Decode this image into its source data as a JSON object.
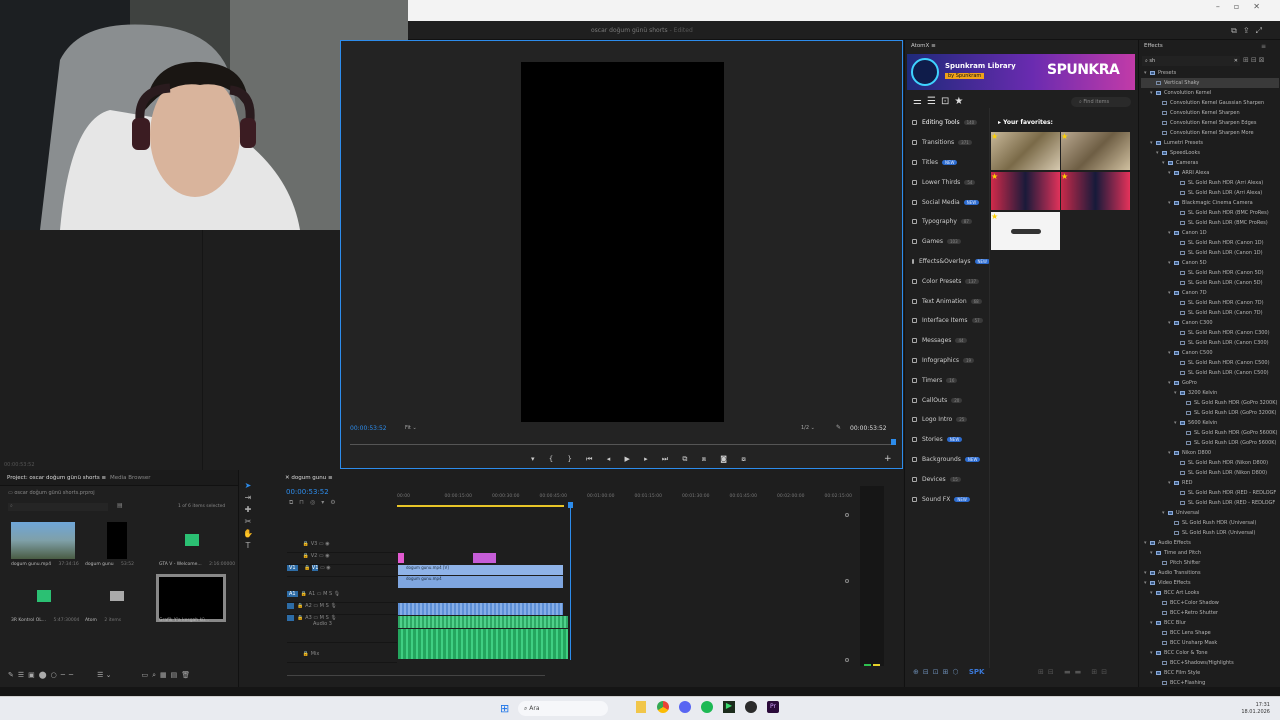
{
  "window": {
    "title": "oscar doğum günü shorts",
    "title_suffix": "- Edited"
  },
  "program_monitor": {
    "timecode_left": "00:00:53:52",
    "fit": "Fit",
    "resolution": "1/2",
    "timecode_right": "00:00:53:52"
  },
  "source_tc": "00:00:53:52",
  "atomx": {
    "panel_tab": "AtomX",
    "banner_title": "Spunkram Library",
    "banner_by": "by Spunkram",
    "brand": "SPUNKRA",
    "find": "Find items",
    "favorites": "Your favorites:",
    "categories": [
      {
        "label": "Editing Tools",
        "badge": "140",
        "hot": false
      },
      {
        "label": "Transitions",
        "badge": "371",
        "hot": false
      },
      {
        "label": "Titles",
        "badge": "NEW",
        "hot": true
      },
      {
        "label": "Lower Thirds",
        "badge": "54",
        "hot": false
      },
      {
        "label": "Social Media",
        "badge": "NEW",
        "hot": true
      },
      {
        "label": "Typography",
        "badge": "87",
        "hot": false
      },
      {
        "label": "Games",
        "badge": "103",
        "hot": false
      },
      {
        "label": "Effects&Overlays",
        "badge": "NEW",
        "hot": true
      },
      {
        "label": "Color Presets",
        "badge": "137",
        "hot": false
      },
      {
        "label": "Text Animation",
        "badge": "68",
        "hot": false
      },
      {
        "label": "Interface Items",
        "badge": "57",
        "hot": false
      },
      {
        "label": "Messages",
        "badge": "44",
        "hot": false
      },
      {
        "label": "Infographics",
        "badge": "19",
        "hot": false
      },
      {
        "label": "Timers",
        "badge": "16",
        "hot": false
      },
      {
        "label": "CallOuts",
        "badge": "20",
        "hot": false
      },
      {
        "label": "Logo Intro",
        "badge": "25",
        "hot": false
      },
      {
        "label": "Stories",
        "badge": "NEW",
        "hot": true
      },
      {
        "label": "Backgrounds",
        "badge": "NEW",
        "hot": true
      },
      {
        "label": "Devices",
        "badge": "15",
        "hot": false
      },
      {
        "label": "Sound FX",
        "badge": "NEW",
        "hot": true
      }
    ]
  },
  "effects": {
    "panel_tab": "Effects",
    "search": "sh",
    "items": [
      {
        "label": "Presets",
        "level": 0,
        "type": "folder"
      },
      {
        "label": "Vertical Shaky",
        "level": 1,
        "type": "fx",
        "sel": true
      },
      {
        "label": "Convolution Kernel",
        "level": 1,
        "type": "folder"
      },
      {
        "label": "Convolution Kernel Gaussian Sharpen",
        "level": 2,
        "type": "fx"
      },
      {
        "label": "Convolution Kernel Sharpen",
        "level": 2,
        "type": "fx"
      },
      {
        "label": "Convolution Kernel Sharpen Edges",
        "level": 2,
        "type": "fx"
      },
      {
        "label": "Convolution Kernel Sharpen More",
        "level": 2,
        "type": "fx"
      },
      {
        "label": "Lumetri Presets",
        "level": 1,
        "type": "folder"
      },
      {
        "label": "SpeedLooks",
        "level": 2,
        "type": "folder"
      },
      {
        "label": "Cameras",
        "level": 3,
        "type": "folder"
      },
      {
        "label": "ARRI Alexa",
        "level": 4,
        "type": "folder"
      },
      {
        "label": "SL Gold Rush HDR (Arri Alexa)",
        "level": 5,
        "type": "fx"
      },
      {
        "label": "SL Gold Rush LDR (Arri Alexa)",
        "level": 5,
        "type": "fx"
      },
      {
        "label": "Blackmagic Cinema Camera",
        "level": 4,
        "type": "folder"
      },
      {
        "label": "SL Gold Rush HDR (BMC ProRes)",
        "level": 5,
        "type": "fx"
      },
      {
        "label": "SL Gold Rush LDR (BMC ProRes)",
        "level": 5,
        "type": "fx"
      },
      {
        "label": "Canon 1D",
        "level": 4,
        "type": "folder"
      },
      {
        "label": "SL Gold Rush HDR (Canon 1D)",
        "level": 5,
        "type": "fx"
      },
      {
        "label": "SL Gold Rush LDR (Canon 1D)",
        "level": 5,
        "type": "fx"
      },
      {
        "label": "Canon 5D",
        "level": 4,
        "type": "folder"
      },
      {
        "label": "SL Gold Rush HDR (Canon 5D)",
        "level": 5,
        "type": "fx"
      },
      {
        "label": "SL Gold Rush LDR (Canon 5D)",
        "level": 5,
        "type": "fx"
      },
      {
        "label": "Canon 7D",
        "level": 4,
        "type": "folder"
      },
      {
        "label": "SL Gold Rush HDR (Canon 7D)",
        "level": 5,
        "type": "fx"
      },
      {
        "label": "SL Gold Rush LDR (Canon 7D)",
        "level": 5,
        "type": "fx"
      },
      {
        "label": "Canon C300",
        "level": 4,
        "type": "folder"
      },
      {
        "label": "SL Gold Rush HDR (Canon C300)",
        "level": 5,
        "type": "fx"
      },
      {
        "label": "SL Gold Rush LDR (Canon C300)",
        "level": 5,
        "type": "fx"
      },
      {
        "label": "Canon C500",
        "level": 4,
        "type": "folder"
      },
      {
        "label": "SL Gold Rush HDR (Canon C500)",
        "level": 5,
        "type": "fx"
      },
      {
        "label": "SL Gold Rush LDR (Canon C500)",
        "level": 5,
        "type": "fx"
      },
      {
        "label": "GoPro",
        "level": 4,
        "type": "folder"
      },
      {
        "label": "3200 Kelvin",
        "level": 5,
        "type": "folder"
      },
      {
        "label": "SL Gold Rush HDR (GoPro 3200K)",
        "level": 6,
        "type": "fx"
      },
      {
        "label": "SL Gold Rush LDR (GoPro 3200K)",
        "level": 6,
        "type": "fx"
      },
      {
        "label": "5600 Kelvin",
        "level": 5,
        "type": "folder"
      },
      {
        "label": "SL Gold Rush HDR (GoPro 5600K)",
        "level": 6,
        "type": "fx"
      },
      {
        "label": "SL Gold Rush LDR (GoPro 5600K)",
        "level": 6,
        "type": "fx"
      },
      {
        "label": "Nikon D800",
        "level": 4,
        "type": "folder"
      },
      {
        "label": "SL Gold Rush HDR (Nikon D800)",
        "level": 5,
        "type": "fx"
      },
      {
        "label": "SL Gold Rush LDR (Nikon D800)",
        "level": 5,
        "type": "fx"
      },
      {
        "label": "RED",
        "level": 4,
        "type": "folder"
      },
      {
        "label": "SL Gold Rush HDR (RED - REDLOGF",
        "level": 5,
        "type": "fx"
      },
      {
        "label": "SL Gold Rush LDR (RED - REDLOGF",
        "level": 5,
        "type": "fx"
      },
      {
        "label": "Universal",
        "level": 3,
        "type": "folder"
      },
      {
        "label": "SL Gold Rush HDR (Universal)",
        "level": 4,
        "type": "fx"
      },
      {
        "label": "SL Gold Rush LDR (Universal)",
        "level": 4,
        "type": "fx"
      },
      {
        "label": "Audio Effects",
        "level": 0,
        "type": "folder"
      },
      {
        "label": "Time and Pitch",
        "level": 1,
        "type": "folder"
      },
      {
        "label": "Pitch Shifter",
        "level": 2,
        "type": "fx"
      },
      {
        "label": "Audio Transitions",
        "level": 0,
        "type": "folder"
      },
      {
        "label": "Video Effects",
        "level": 0,
        "type": "folder"
      },
      {
        "label": "BCC Art Looks",
        "level": 1,
        "type": "folder"
      },
      {
        "label": "BCC+Color Shadow",
        "level": 2,
        "type": "fx"
      },
      {
        "label": "BCC+Retro Shutter",
        "level": 2,
        "type": "fx"
      },
      {
        "label": "BCC Blur",
        "level": 1,
        "type": "folder"
      },
      {
        "label": "BCC Lens Shape",
        "level": 2,
        "type": "fx"
      },
      {
        "label": "BCC Unsharp Mask",
        "level": 2,
        "type": "fx"
      },
      {
        "label": "BCC Color & Tone",
        "level": 1,
        "type": "folder"
      },
      {
        "label": "BCC+Shadows/Highlights",
        "level": 2,
        "type": "fx"
      },
      {
        "label": "BCC Film Style",
        "level": 1,
        "type": "folder"
      },
      {
        "label": "BCC+Flashing",
        "level": 2,
        "type": "fx"
      }
    ]
  },
  "project": {
    "tab": "Project: oscar doğum günü shorts",
    "tab2": "Media Browser",
    "path": "oscar doğum günü shorts.prproj",
    "count": "1 of 6 items selected",
    "items": [
      {
        "name": "dogum gunu.mp4",
        "meta": "37:34:16",
        "kind": "video"
      },
      {
        "name": "dogum gunu",
        "meta": "53:52",
        "kind": "black"
      },
      {
        "name": "GTA V - Welcome...",
        "meta": "2:16:00000",
        "kind": "audio"
      },
      {
        "name": "3R Kontrol OL...",
        "meta": "5:47:30004",
        "kind": "audio"
      },
      {
        "name": "Atom",
        "meta": "2 items",
        "kind": "folder"
      },
      {
        "name": "Grafik Y'a kesgah kü...",
        "meta": "",
        "kind": "blacksel"
      }
    ]
  },
  "timeline": {
    "tab": "dogum gunu",
    "timecode": "00:00:53:52",
    "ruler": [
      "00:00",
      "00:00:15:00",
      "00:00:30:00",
      "00:00:45:00",
      "00:01:00:00",
      "00:01:15:00",
      "00:01:30:00",
      "00:01:45:00",
      "00:02:00:00",
      "00:02:15:00"
    ],
    "clip_v1": "dogum gunu.mp4 [V]",
    "clip_v2": "dogum gunu.mp4",
    "audio_label": "Audio 3",
    "mix": "Mix"
  },
  "taskbar": {
    "search": "Ara",
    "time": "17:31",
    "date": "18.01.2026"
  }
}
